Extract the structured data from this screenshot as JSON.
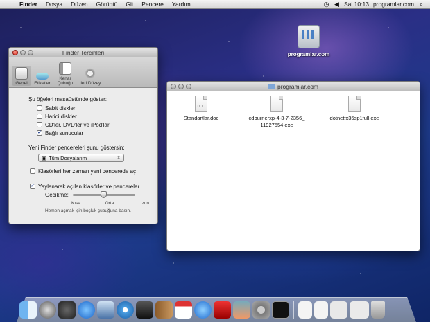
{
  "menubar": {
    "app": "Finder",
    "items": [
      "Dosya",
      "Düzen",
      "Görüntü",
      "Git",
      "Pencere",
      "Yardım"
    ],
    "clock": "Sal 10:13",
    "site": "programlar.com"
  },
  "desktop_icon": {
    "label": "programlar.com"
  },
  "prefs_window": {
    "title": "Finder Tercihleri",
    "tabs": [
      "Genel",
      "Etiketler",
      "Kenar Çubuğu",
      "İleri Düzey"
    ],
    "show_on_desktop_label": "Şu öğeleri masaüstünde göster:",
    "desktop_items": [
      {
        "label": "Sabit diskler",
        "checked": false
      },
      {
        "label": "Harici diskler",
        "checked": false
      },
      {
        "label": "CD'ler, DVD'ler ve iPod'lar",
        "checked": false
      },
      {
        "label": "Bağlı sunucular",
        "checked": true
      }
    ],
    "new_window_label": "Yeni Finder pencereleri şunu göstersin:",
    "new_window_value": "Tüm Dosyalarım",
    "always_new_window_label": "Klasörleri her zaman yeni pencerede aç",
    "springload_label": "Yaylanarak açılan klasörler ve pencereler",
    "delay_label": "Gecikme:",
    "delay_ticks": [
      "Kısa",
      "Orta",
      "Uzun"
    ],
    "hint": "Hemen açmak için boşluk çubuğuna basın."
  },
  "folder_window": {
    "title": "programlar.com",
    "files": [
      {
        "name": "Standartlar.doc",
        "badge": "DOC"
      },
      {
        "name": "cdburnerxp-4-3-7-2356_11927554.exe",
        "line1": "cdburnerxp-4-3-7-2356_",
        "line2": "11927554.exe"
      },
      {
        "name": "dotnetfx35sp1full.exe"
      }
    ]
  },
  "dock": {
    "apps": [
      "finder-icon",
      "launchpad-icon",
      "dashboard-icon",
      "app-store-icon",
      "preview-icon",
      "safari-icon",
      "facetime-icon",
      "address-book-icon",
      "calendar-icon",
      "itunes-icon",
      "photo-booth-icon",
      "iphoto-icon",
      "system-preferences-icon",
      "terminal-icon"
    ],
    "docs": [
      "document-icon",
      "document-icon",
      "document-icon",
      "document-icon",
      "trash-icon"
    ]
  },
  "colors": {
    "red_light": "#d0261a",
    "selection": "#4a80c4"
  }
}
